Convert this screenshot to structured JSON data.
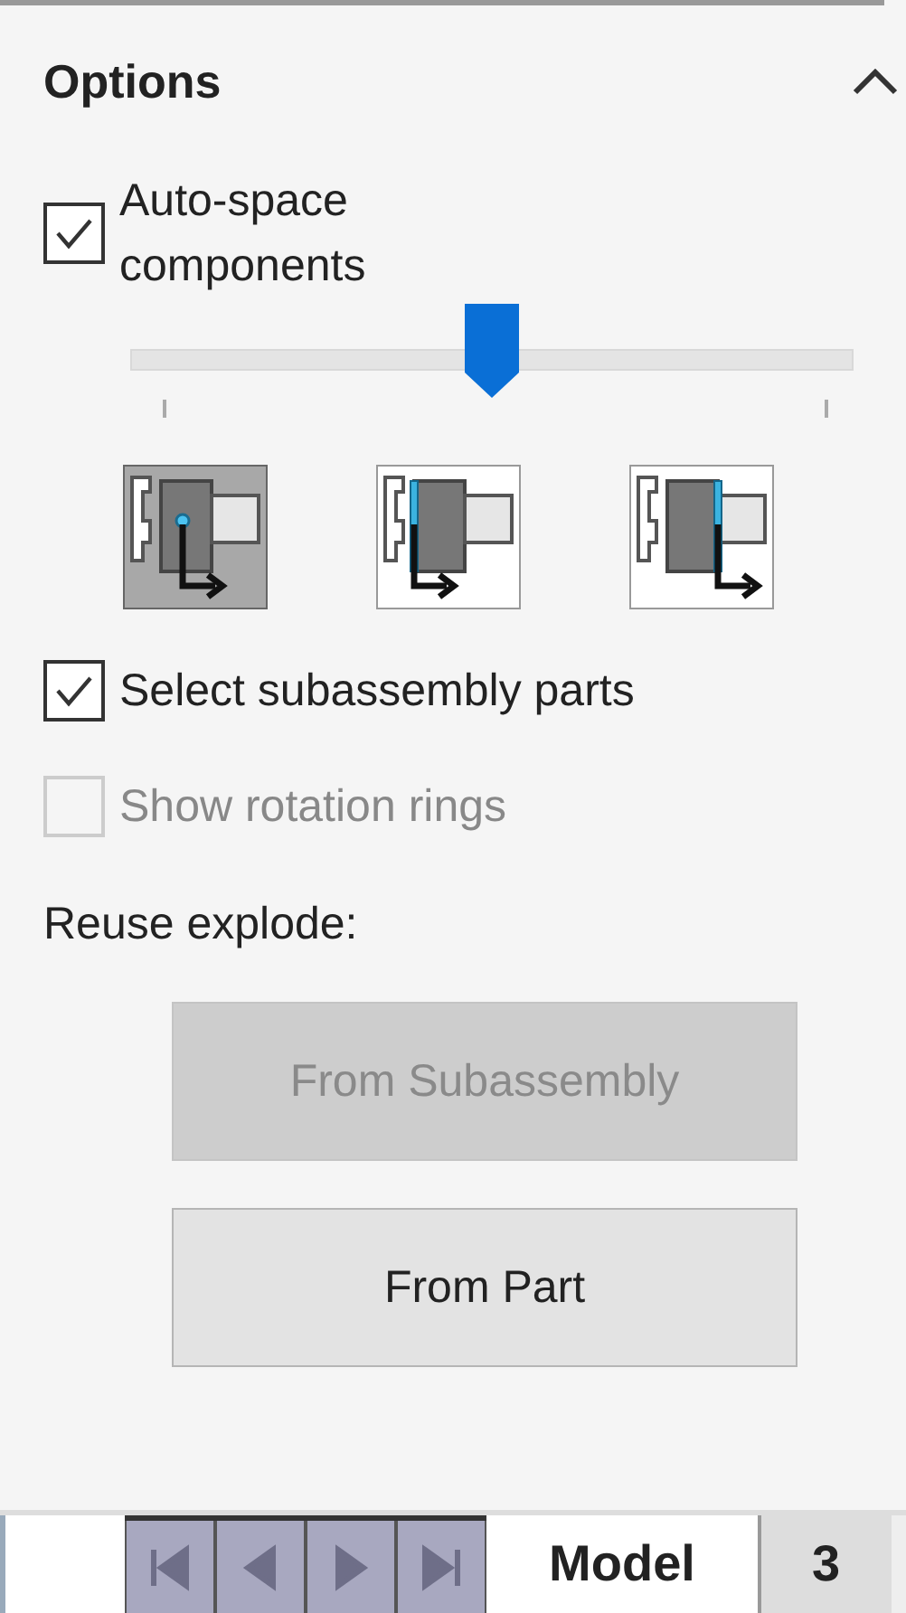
{
  "section": {
    "title": "Options",
    "expanded": true
  },
  "auto_space": {
    "label": "Auto-space components",
    "checked": true
  },
  "spacing_slider": {
    "level": 0.5
  },
  "mode_buttons": [
    {
      "kind": "center",
      "selected": true
    },
    {
      "kind": "left-face",
      "selected": false
    },
    {
      "kind": "right-face",
      "selected": false
    }
  ],
  "checkboxes": [
    {
      "label": "Select subassembly parts",
      "checked": true,
      "disabled": false
    },
    {
      "label": "Show rotation rings",
      "checked": false,
      "disabled": true
    }
  ],
  "reuse_label": "Reuse explode:",
  "buttons": [
    {
      "label": "From Subassembly",
      "disabled": true
    },
    {
      "label": "From Part",
      "disabled": false
    }
  ],
  "bottom_tabs": [
    {
      "label": "Model",
      "selected": true
    },
    {
      "label": "3",
      "selected": false
    }
  ]
}
